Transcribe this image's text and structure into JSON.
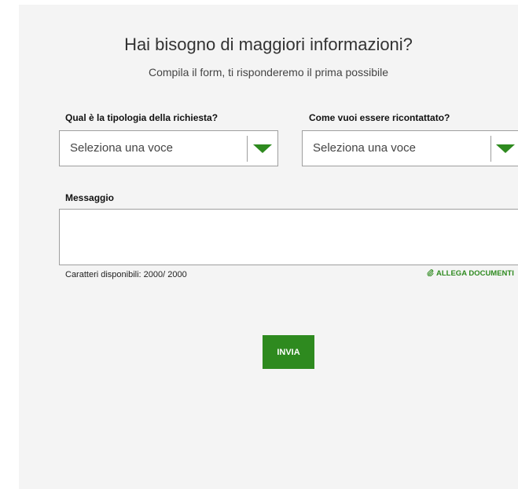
{
  "header": {
    "title": "Hai bisogno di maggiori informazioni?",
    "subtitle": "Compila il form, ti risponderemo il prima possibile"
  },
  "form": {
    "request_type": {
      "label": "Qual è la tipologia della richiesta?",
      "selected": "Seleziona una voce"
    },
    "contact_method": {
      "label": "Come vuoi essere ricontattato?",
      "selected": "Seleziona una voce"
    },
    "message": {
      "label": "Messaggio",
      "value": "",
      "counter": "Caratteri disponibili: 2000/ 2000"
    },
    "attach_label": "ALLEGA DOCUMENTI",
    "submit_label": "INVIA"
  },
  "icons": {
    "dropdown": "chevron-down-icon",
    "attach": "paperclip-icon"
  },
  "colors": {
    "accent": "#2e8a1f",
    "panel_background": "#f4f4f4",
    "border": "#9e9e9e"
  }
}
